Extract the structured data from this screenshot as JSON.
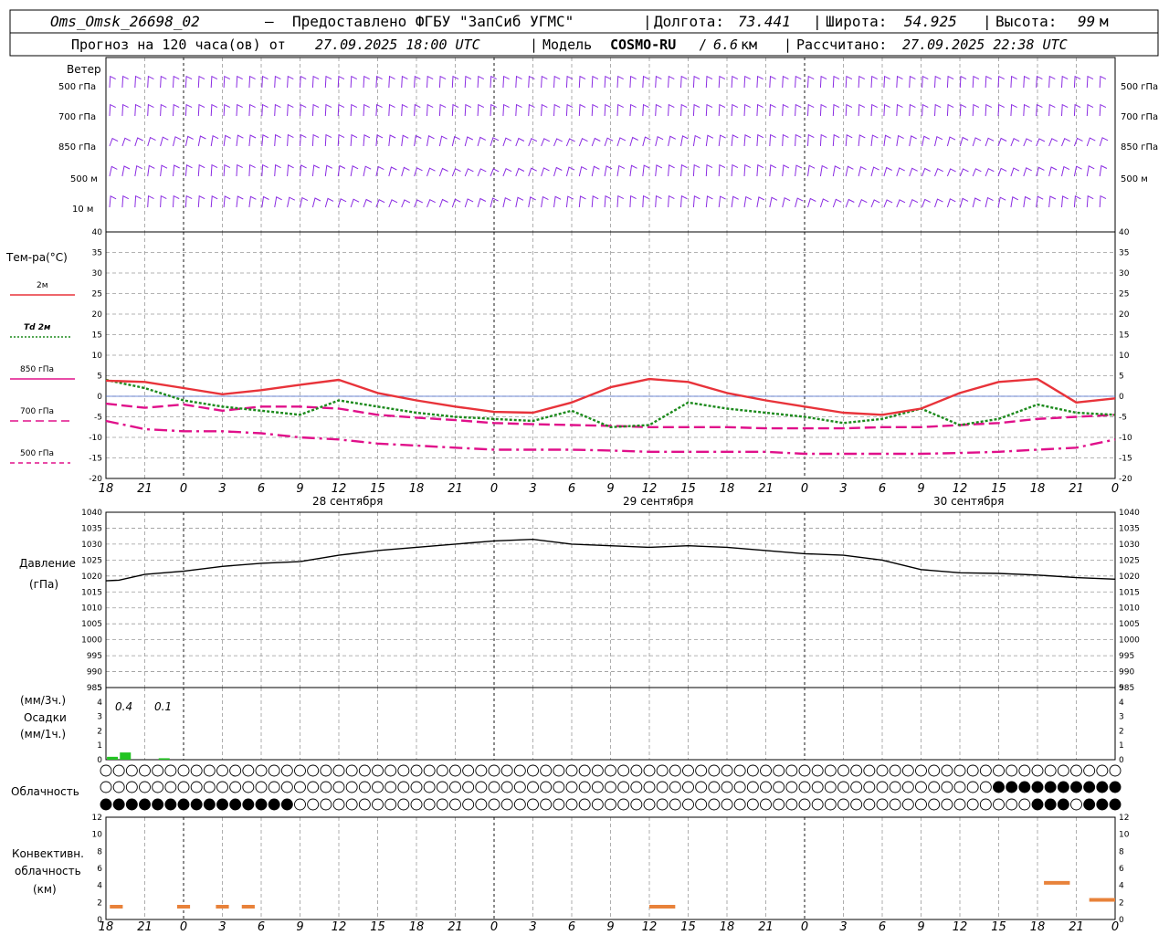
{
  "header": {
    "station": "Oms_Omsk_26698_02",
    "dash": "–",
    "provider": "Предоставлено ФГБУ \"ЗапСиб УГМС\"",
    "lon_label": "Долгота:",
    "lon": "73.441",
    "lat_label": "Широта:",
    "lat": "54.925",
    "height_label": "Высота:",
    "height": "99",
    "height_unit": "м",
    "forecast_prefix": "Прогноз на 120 часа(ов) от",
    "forecast_time": "27.09.2025 18:00 UTC",
    "model_label": "Модель",
    "model": "COSMO-RU",
    "model_sep": "/",
    "model_res": "6.6",
    "model_res_unit": "км",
    "calc_label": "Рассчитано:",
    "calc_time": "27.09.2025 22:38 UTC"
  },
  "wind_panel": {
    "title": "Ветер",
    "levels": [
      "500 гПа",
      "700 гПа",
      "850 гПа",
      "500 м",
      "10  м"
    ],
    "color": "#8a2be2"
  },
  "temp_panel": {
    "title": "Тем-ра(°C)",
    "legend": [
      {
        "label": "2м",
        "color": "#e8333a",
        "style": "solid"
      },
      {
        "label": "Td  2м",
        "color": "#1c8a1c",
        "style": "dotted"
      },
      {
        "label": "850 гПа",
        "color": "#e0108a",
        "style": "dash"
      },
      {
        "label": "700 гПа",
        "color": "#e0108a",
        "style": "longdash"
      },
      {
        "label": "500 гПа",
        "color": "#e0108a",
        "style": "dashdot"
      }
    ]
  },
  "pressure_panel": {
    "title": "Давление",
    "unit": "(гПа)"
  },
  "precip_panel": {
    "unit3h": "(мм/3ч.)",
    "title": "Осадки",
    "unit1h": "(мм/1ч.)",
    "annotations": [
      "0.4",
      "0.1"
    ],
    "color": "#22c422"
  },
  "cloud_panel": {
    "title": "Облачность"
  },
  "conv_panel": {
    "title1": "Конвективн.",
    "title2": "облачность",
    "unit": "(км)",
    "color": "#e8823a"
  },
  "x_tick_labels": [
    "18",
    "21",
    "0",
    "3",
    "6",
    "9",
    "12",
    "15",
    "18",
    "21",
    "0",
    "3",
    "6",
    "9",
    "12",
    "15",
    "18",
    "21",
    "0",
    "3",
    "6",
    "9",
    "12",
    "15",
    "18",
    "21",
    "0"
  ],
  "day_labels": [
    "28 сентября",
    "29 сентября",
    "30 сентября"
  ],
  "chart_data": [
    {
      "type": "line",
      "title": "Тем-ра(°C)",
      "x_hours": [
        0,
        3,
        6,
        9,
        12,
        15,
        18,
        21,
        24,
        27,
        30,
        33,
        36,
        39,
        42,
        45,
        48,
        51,
        54,
        57,
        60,
        63,
        66,
        69,
        72,
        75,
        78
      ],
      "ylim": [
        -20,
        40
      ],
      "yticks": [
        -20,
        -15,
        -10,
        -5,
        0,
        5,
        10,
        15,
        20,
        25,
        30,
        35,
        40
      ],
      "series": [
        {
          "name": "2м",
          "color": "#e8333a",
          "style": "solid",
          "x": [
            0,
            3,
            6,
            9,
            12,
            15,
            18,
            21,
            24,
            27,
            30,
            33,
            36,
            39,
            42,
            45,
            48,
            51,
            54,
            57,
            60,
            63,
            66,
            69,
            72,
            75,
            78
          ],
          "values": [
            3.8,
            3.5,
            2,
            0.5,
            1.5,
            2.8,
            4,
            0.8,
            -1,
            -2.5,
            -3.8,
            -4,
            -1.5,
            2.2,
            4.2,
            3.5,
            0.8,
            -1,
            -2.5,
            -4,
            -4.5,
            -3,
            0.8,
            3.5,
            4.2,
            -1.5,
            -0.5
          ]
        },
        {
          "name": "Td  2м",
          "color": "#1c8a1c",
          "style": "dotted",
          "x": [
            0,
            3,
            6,
            9,
            12,
            15,
            18,
            21,
            24,
            27,
            30,
            33,
            36,
            39,
            42,
            45,
            48,
            51,
            54,
            57,
            60,
            63,
            66,
            69,
            72,
            75,
            78
          ],
          "values": [
            4,
            2,
            -1,
            -2.5,
            -3.5,
            -4.5,
            -1,
            -2.5,
            -4,
            -5,
            -5.5,
            -6,
            -3.5,
            -7.5,
            -7,
            -1.5,
            -3,
            -4,
            -5,
            -6.5,
            -5.5,
            -3,
            -7,
            -5.5,
            -2,
            -4,
            -4.5
          ]
        },
        {
          "name": "850 гПа",
          "color": "#e0108a",
          "style": "dash",
          "x": [
            0,
            3,
            6,
            9,
            12,
            15,
            18,
            21,
            24,
            27,
            30,
            33,
            36,
            39,
            42,
            45,
            48,
            51,
            54,
            57,
            60,
            63,
            66,
            69,
            72,
            75,
            78
          ],
          "values": [
            -1.8,
            -2.8,
            -2,
            -3.5,
            -2.5,
            -2.5,
            -3,
            -4.5,
            -5.2,
            -5.8,
            -6.5,
            -6.8,
            -7,
            -7.2,
            -7.5,
            -7.5,
            -7.5,
            -7.8,
            -7.8,
            -7.8,
            -7.5,
            -7.5,
            -7,
            -6.5,
            -5.5,
            -5,
            -4.5
          ]
        },
        {
          "name": "700 гПа",
          "color": "#e0108a",
          "style": "longdash",
          "x": [
            0,
            3,
            6,
            9,
            12,
            15,
            18,
            21,
            24,
            27,
            30,
            33,
            36,
            39,
            42,
            45,
            48,
            51,
            54,
            57,
            60,
            63,
            66,
            69,
            72,
            75,
            78
          ],
          "values": [
            -1.8,
            -2.8,
            -2,
            -3.5,
            -2.5,
            -2.5,
            -3,
            -4.5,
            -5.2,
            -5.8,
            -6.5,
            -6.8,
            -7,
            -7.2,
            -7.5,
            -7.5,
            -7.5,
            -7.8,
            -7.8,
            -7.8,
            -7.5,
            -7.5,
            -7,
            -6.5,
            -5.5,
            -5,
            -4.5
          ]
        },
        {
          "name": "500 гПа",
          "color": "#e0108a",
          "style": "dashdot",
          "x": [
            0,
            3,
            6,
            9,
            12,
            15,
            18,
            21,
            24,
            27,
            30,
            33,
            36,
            39,
            42,
            45,
            48,
            51,
            54,
            57,
            60,
            63,
            66,
            69,
            72,
            75,
            78
          ],
          "values": [
            -6,
            -8,
            -8.5,
            -8.5,
            -9,
            -10,
            -10.5,
            -11.5,
            -12,
            -12.5,
            -13,
            -13,
            -13,
            -13.2,
            -13.5,
            -13.5,
            -13.5,
            -13.5,
            -14,
            -14,
            -14,
            -14,
            -13.8,
            -13.5,
            -13,
            -12.5,
            -10.5
          ]
        }
      ]
    },
    {
      "type": "line",
      "title": "Давление",
      "ylabel": "(гПа)",
      "ylim": [
        985,
        1040
      ],
      "yticks": [
        985,
        990,
        995,
        1000,
        1005,
        1010,
        1015,
        1020,
        1025,
        1030,
        1035,
        1040
      ],
      "series": [
        {
          "name": "Давление",
          "color": "#000000",
          "x": [
            0,
            1,
            3,
            6,
            9,
            12,
            15,
            18,
            21,
            24,
            27,
            30,
            33,
            36,
            39,
            42,
            45,
            48,
            51,
            54,
            57,
            60,
            63,
            66,
            69,
            72,
            75,
            78
          ],
          "values": [
            1018.5,
            1018.7,
            1020.5,
            1021.5,
            1023,
            1024,
            1024.5,
            1026.5,
            1028,
            1029,
            1030,
            1031,
            1031.5,
            1030,
            1029.5,
            1029,
            1029.5,
            1029,
            1028,
            1027,
            1026.5,
            1025,
            1022,
            1021,
            1020.8,
            1020.3,
            1019.5,
            1019
          ]
        }
      ]
    },
    {
      "type": "bar",
      "title": "Осадки",
      "ylim": [
        0,
        5
      ],
      "yticks": [
        0,
        1,
        2,
        3,
        4,
        5
      ],
      "x_hours": [
        0.5,
        1.5,
        4.5
      ],
      "values": [
        0.2,
        0.5,
        0.1
      ]
    },
    {
      "type": "bar",
      "title": "Конвективн. облачность",
      "ylabel": "(км)",
      "ylim": [
        0,
        12
      ],
      "yticks": [
        0,
        2,
        4,
        6,
        8,
        10,
        12
      ],
      "segments": [
        {
          "x0": 0.3,
          "x1": 1.3,
          "value": 1.5
        },
        {
          "x0": 5.5,
          "x1": 6.5,
          "value": 1.5
        },
        {
          "x0": 8.5,
          "x1": 9.5,
          "value": 1.5
        },
        {
          "x0": 10.5,
          "x1": 11.5,
          "value": 1.5
        },
        {
          "x0": 42,
          "x1": 44,
          "value": 1.5
        },
        {
          "x0": 72.5,
          "x1": 74.5,
          "value": 4.3
        },
        {
          "x0": 76,
          "x1": 78,
          "value": 2.3
        }
      ]
    }
  ]
}
